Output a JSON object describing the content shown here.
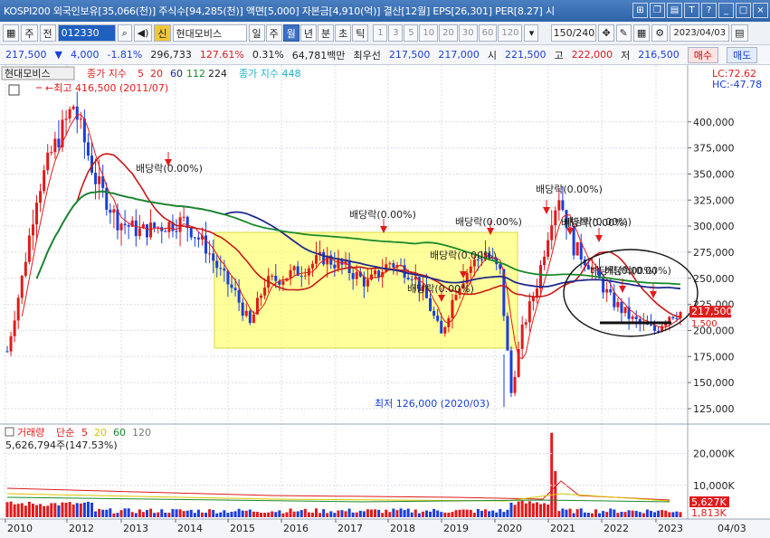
{
  "window": {
    "title": "KOSPI200 외국인보유[35,066(천)] 주식수[94,285(천)] 액면[5,000] 자본금[4,910(억)] 결산[12월] EPS[26,301] PER[8.27] 시"
  },
  "toolbar": {
    "type_label": "주",
    "prev_label": "전",
    "code_value": "012330",
    "sin_label": "신",
    "stock_name": "현대모비스",
    "period_labels": [
      "일",
      "주",
      "월",
      "년",
      "분",
      "초",
      "틱"
    ],
    "selected_period": "월",
    "interval_labels": [
      "1",
      "3",
      "5",
      "10",
      "20",
      "30",
      "60",
      "120"
    ],
    "count_value": "150/240",
    "date_value": "2023/04/03"
  },
  "quote": {
    "price": "217,500",
    "change": "4,000",
    "change_pct": "-1.81%",
    "volume": "296,733",
    "vol_ratio": "127.61%",
    "turnover": "0.31%",
    "trade_value": "64,781백만",
    "prefer_label": "최우선",
    "prefer_ask": "217,500",
    "prefer_bid": "217,000",
    "open_label": "시",
    "open": "221,500",
    "high_label": "고",
    "high": "222,000",
    "low_label": "저",
    "low": "216,500",
    "buy_label": "매수",
    "sell_label": "매도"
  },
  "chart_data": {
    "type": "candlestick",
    "legend": {
      "stock": "현대모비스",
      "ma_prefix": "종가 지수",
      "periods": [
        "5",
        "20",
        "60",
        "112",
        "224"
      ],
      "ma2": "종가 지수 448"
    },
    "indicators": {
      "lc": "LC:72.62",
      "hc": "HC:-47.78"
    },
    "y_axis": {
      "ticks": [
        "400,000",
        "375,000",
        "350,000",
        "325,000",
        "300,000",
        "275,000",
        "250,000",
        "225,000",
        "200,000",
        "175,000",
        "150,000",
        "125,000"
      ],
      "range": [
        118000,
        418000
      ],
      "current": "217,500",
      "current_sub": "1,500"
    },
    "x_axis": {
      "ticks": [
        "2010",
        "2012",
        "2013",
        "2014",
        "2015",
        "2016",
        "2017",
        "2018",
        "2019",
        "2020",
        "2021",
        "2022",
        "2023"
      ],
      "last_label": "04/03"
    },
    "annotations": {
      "high": "←최고 416,500 (2011/07)",
      "low": "최저 126,000 (2020/03)",
      "dividend": "배당락(0.00%)"
    },
    "volume": {
      "title": "거래량",
      "ma_label": "단순",
      "periods": [
        "5",
        "20",
        "60",
        "120"
      ],
      "value_label": "5,626,794주(147.53%)",
      "ticks": [
        "20,000K",
        "10,000K"
      ],
      "current": "5,627K",
      "ma_current": "1,813K"
    }
  }
}
